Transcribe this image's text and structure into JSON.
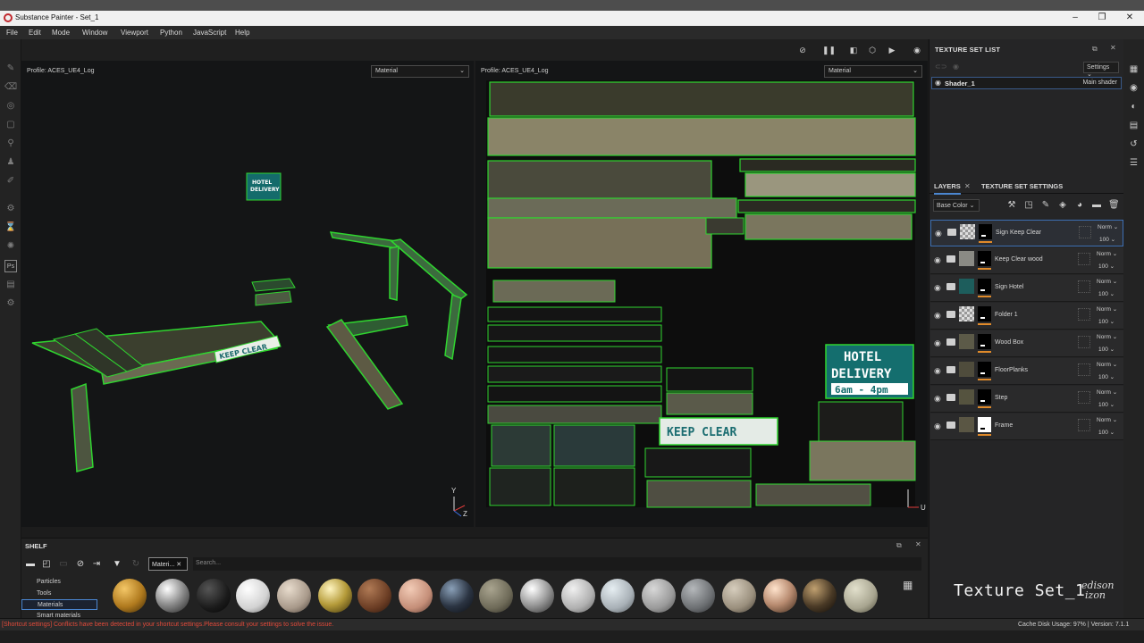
{
  "window": {
    "title": "Substance Painter - Set_1",
    "minimize_icon": "minimize-icon",
    "maximize_icon": "maximize-icon",
    "close_icon": "close-icon"
  },
  "menu": [
    "File",
    "Edit",
    "Mode",
    "Window",
    "Viewport",
    "Python",
    "JavaScript",
    "Help"
  ],
  "viewport_3d": {
    "profile": "Profile: ACES_UE4_Log",
    "mode": "Material",
    "sign_keep_clear": "KEEP CLEAR",
    "sign_hotel_1": "HOTEL",
    "sign_hotel_2": "DELIVERY",
    "axis_y": "Y",
    "axis_z": "Z"
  },
  "viewport_2d": {
    "profile": "Profile: ACES_UE4_Log",
    "mode": "Material",
    "sign_keep_clear": "KEEP CLEAR",
    "sign_hotel_1": "HOTEL",
    "sign_hotel_2": "DELIVERY",
    "sign_hotel_3": "6am - 4pm",
    "axis_v": "V",
    "axis_u": "U"
  },
  "texture_set_list": {
    "title": "TEXTURE SET LIST",
    "settings": "Settings",
    "shader_name": "Shader_1",
    "shader_type": "Main shader"
  },
  "layers_panel": {
    "tab_layers": "LAYERS",
    "tab_settings": "TEXTURE SET SETTINGS",
    "channel": "Base Color",
    "layers": [
      {
        "name": "Sign Keep Clear",
        "blend": "Norm",
        "opacity": "100"
      },
      {
        "name": "Keep Clear wood",
        "blend": "Norm",
        "opacity": "100"
      },
      {
        "name": "Sign Hotel",
        "blend": "Norm",
        "opacity": "100"
      },
      {
        "name": "Folder 1",
        "blend": "Norm",
        "opacity": "100"
      },
      {
        "name": "Wood Box",
        "blend": "Norm",
        "opacity": "100"
      },
      {
        "name": "FloorPlanks",
        "blend": "Norm",
        "opacity": "100"
      },
      {
        "name": "Step",
        "blend": "Norm",
        "opacity": "100"
      },
      {
        "name": "Frame",
        "blend": "Norm",
        "opacity": "100"
      }
    ],
    "overlay_title": "Texture Set_1",
    "signature_1": "edison",
    "signature_2": "izon"
  },
  "shelf": {
    "title": "SHELF",
    "filter_chip": "Materi...",
    "search_placeholder": "Search...",
    "categories": [
      "Particles",
      "Tools",
      "Materials",
      "Smart materials"
    ],
    "selected_category": "Materials"
  },
  "status": {
    "error": "[Shortcut settings] Conflicts have been detected in your shortcut settings.Please consult your settings to solve the issue.",
    "disk": "Cache Disk Usage:   97% | Version: 7.1.1"
  },
  "colors": {
    "uv_outline": "#2fd52f",
    "accent": "#4b86d0",
    "error": "#e14a3a",
    "mask_orange": "#e08a2a"
  }
}
